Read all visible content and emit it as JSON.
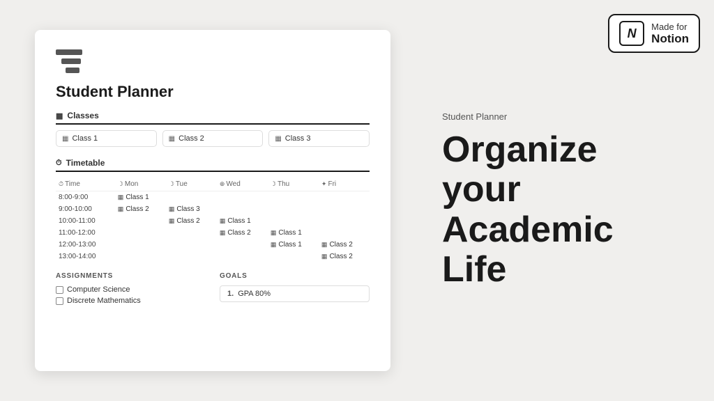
{
  "badge": {
    "made_for": "Made for",
    "notion": "Notion"
  },
  "right": {
    "subtitle": "Student Planner",
    "title_line1": "Organize your",
    "title_line2": "Academic Life"
  },
  "doc": {
    "title": "Student Planner",
    "sections": {
      "classes": {
        "label": "Classes",
        "items": [
          {
            "name": "Class 1"
          },
          {
            "name": "Class 2"
          },
          {
            "name": "Class 3"
          }
        ]
      },
      "timetable": {
        "label": "Timetable",
        "columns": [
          "Time",
          "Mon",
          "Tue",
          "Wed",
          "Thu",
          "Fri"
        ],
        "rows": [
          {
            "time": "8:00-9:00",
            "mon": "Class 1",
            "tue": "",
            "wed": "",
            "thu": "",
            "fri": ""
          },
          {
            "time": "9:00-10:00",
            "mon": "Class 2",
            "tue": "Class 3",
            "wed": "",
            "thu": "",
            "fri": ""
          },
          {
            "time": "10:00-11:00",
            "mon": "",
            "tue": "Class 2",
            "wed": "Class 1",
            "thu": "",
            "fri": ""
          },
          {
            "time": "11:00-12:00",
            "mon": "",
            "tue": "",
            "wed": "Class 2",
            "thu": "Class 1",
            "fri": ""
          },
          {
            "time": "12:00-13:00",
            "mon": "",
            "tue": "",
            "wed": "",
            "thu": "Class 1",
            "fri": "Class 2"
          },
          {
            "time": "13:00-14:00",
            "mon": "",
            "tue": "",
            "wed": "",
            "thu": "",
            "fri": "Class 2"
          }
        ]
      },
      "assignments": {
        "label": "ASSIGNMENTS",
        "items": [
          "Computer Science",
          "Discrete Mathematics"
        ]
      },
      "goals": {
        "label": "GOALS",
        "items": [
          {
            "num": "1.",
            "text": "GPA 80%"
          }
        ]
      }
    }
  }
}
